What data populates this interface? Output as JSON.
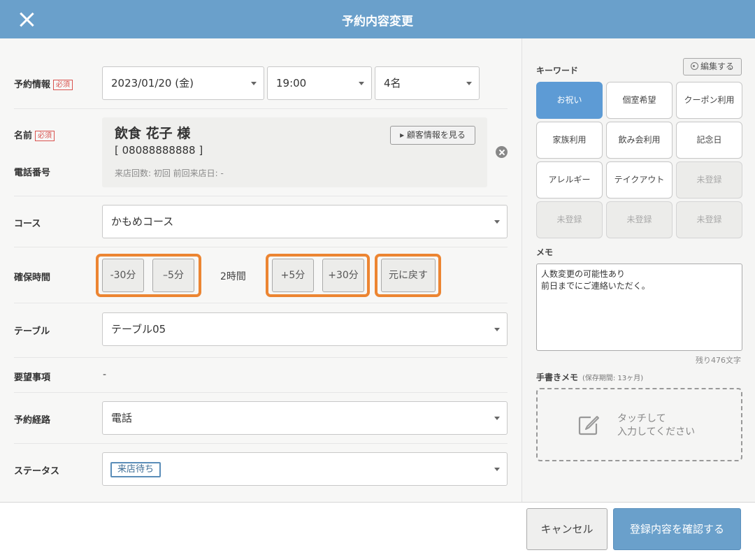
{
  "header": {
    "title": "予約内容変更"
  },
  "form": {
    "reservation": {
      "label": "予約情報",
      "required": "必須",
      "date": "2023/01/20 (金)",
      "time": "19:00",
      "people": "4名"
    },
    "name": {
      "label": "名前",
      "required": "必須"
    },
    "phone": {
      "label": "電話番号"
    },
    "customer": {
      "name": "飲食 花子 様",
      "phone": "[ 08088888888 ]",
      "visits": "来店回数:  初回    前回来店日:  -",
      "view_button": "▸ 顧客情報を見る"
    },
    "course": {
      "label": "コース",
      "value": "かもめコース"
    },
    "hold_time": {
      "label": "確保時間",
      "minus30": "-30分",
      "minus5": "–5分",
      "duration": "2時間",
      "plus5": "+5分",
      "plus30": "+30分",
      "reset": "元に戻す"
    },
    "table": {
      "label": "テーブル",
      "value": "テーブル05"
    },
    "requests": {
      "label": "要望事項",
      "value": "-"
    },
    "route": {
      "label": "予約経路",
      "value": "電話"
    },
    "status": {
      "label": "ステータス",
      "value": "来店待ち"
    }
  },
  "keywords": {
    "title": "キーワード",
    "edit_button": "編集する",
    "items": [
      {
        "label": "お祝い",
        "state": "active"
      },
      {
        "label": "個室希望",
        "state": "normal"
      },
      {
        "label": "クーポン利用",
        "state": "normal"
      },
      {
        "label": "家族利用",
        "state": "normal"
      },
      {
        "label": "飲み会利用",
        "state": "normal"
      },
      {
        "label": "記念日",
        "state": "normal"
      },
      {
        "label": "アレルギー",
        "state": "normal"
      },
      {
        "label": "テイクアウト",
        "state": "normal"
      },
      {
        "label": "未登録",
        "state": "empty"
      },
      {
        "label": "未登録",
        "state": "empty"
      },
      {
        "label": "未登録",
        "state": "empty"
      },
      {
        "label": "未登録",
        "state": "empty"
      }
    ]
  },
  "memo": {
    "title": "メモ",
    "text": "人数変更の可能性あり\n前日までにご連絡いただく。",
    "remaining": "残り476文字"
  },
  "handwriting": {
    "title": "手書きメモ",
    "subtitle": "(保存期間: 13ヶ月)",
    "line1": "タッチして",
    "line2": "入力してください"
  },
  "footer": {
    "cancel": "キャンセル",
    "confirm": "登録内容を確認する"
  },
  "colors": {
    "header": "#6aa0cb",
    "highlight": "#ec8532",
    "active_keyword": "#5d9bd5"
  }
}
